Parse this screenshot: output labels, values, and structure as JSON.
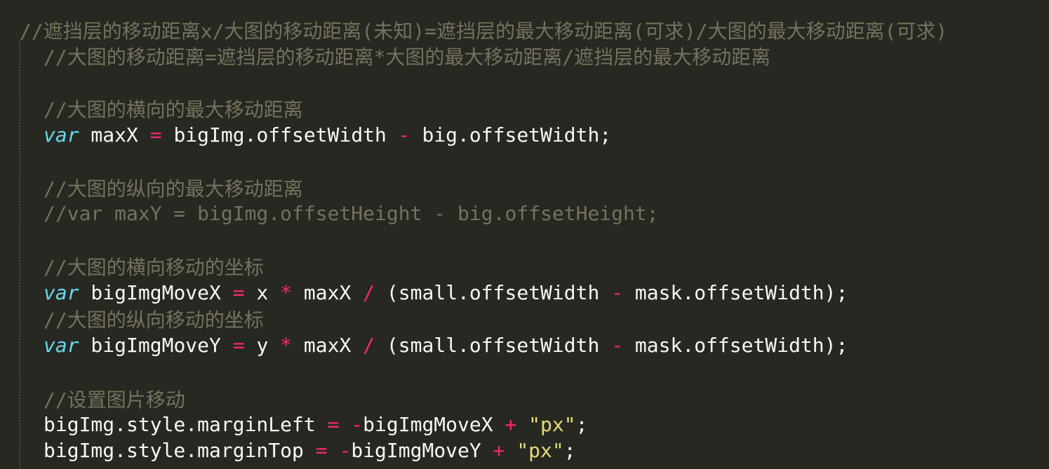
{
  "editor": {
    "theme": {
      "background": "#272822",
      "comment": "#75715e",
      "keyword": "#66d9ef",
      "operator": "#f92672",
      "string": "#e6db74",
      "text": "#f8f8f2"
    },
    "lines": {
      "l1": "//遮挡层的移动距离x/大图的移动距离(未知)=遮挡层的最大移动距离(可求)/大图的最大移动距离(可求)",
      "l2": "//大图的移动距离=遮挡层的移动距离*大图的最大移动距离/遮挡层的最大移动距离",
      "l3": "//大图的横向的最大移动距离",
      "l4": {
        "kw": "var",
        "a": " maxX ",
        "op1": "=",
        "b": " bigImg.offsetWidth ",
        "op2": "-",
        "c": " big.offsetWidth;"
      },
      "l5": "//大图的纵向的最大移动距离",
      "l6": "//var maxY = bigImg.offsetHeight - big.offsetHeight;",
      "l7": "//大图的横向移动的坐标",
      "l8": {
        "kw": "var",
        "a": " bigImgMoveX ",
        "op1": "=",
        "b": " x ",
        "op2": "*",
        "c": " maxX ",
        "op3": "/",
        "d": " (small.offsetWidth ",
        "op4": "-",
        "e": " mask.offsetWidth);"
      },
      "l9": "//大图的纵向移动的坐标",
      "l10": {
        "kw": "var",
        "a": " bigImgMoveY ",
        "op1": "=",
        "b": " y ",
        "op2": "*",
        "c": " maxX ",
        "op3": "/",
        "d": " (small.offsetWidth ",
        "op4": "-",
        "e": " mask.offsetWidth);"
      },
      "l11": "//设置图片移动",
      "l12": {
        "a": "bigImg.style.marginLeft ",
        "op1": "=",
        "b": " ",
        "op2": "-",
        "c": "bigImgMoveX ",
        "op3": "+",
        "d": " ",
        "str": "\"px\"",
        "e": ";"
      },
      "l13": {
        "a": "bigImg.style.marginTop ",
        "op1": "=",
        "b": " ",
        "op2": "-",
        "c": "bigImgMoveY ",
        "op3": "+",
        "d": " ",
        "str": "\"px\"",
        "e": ";"
      }
    }
  }
}
